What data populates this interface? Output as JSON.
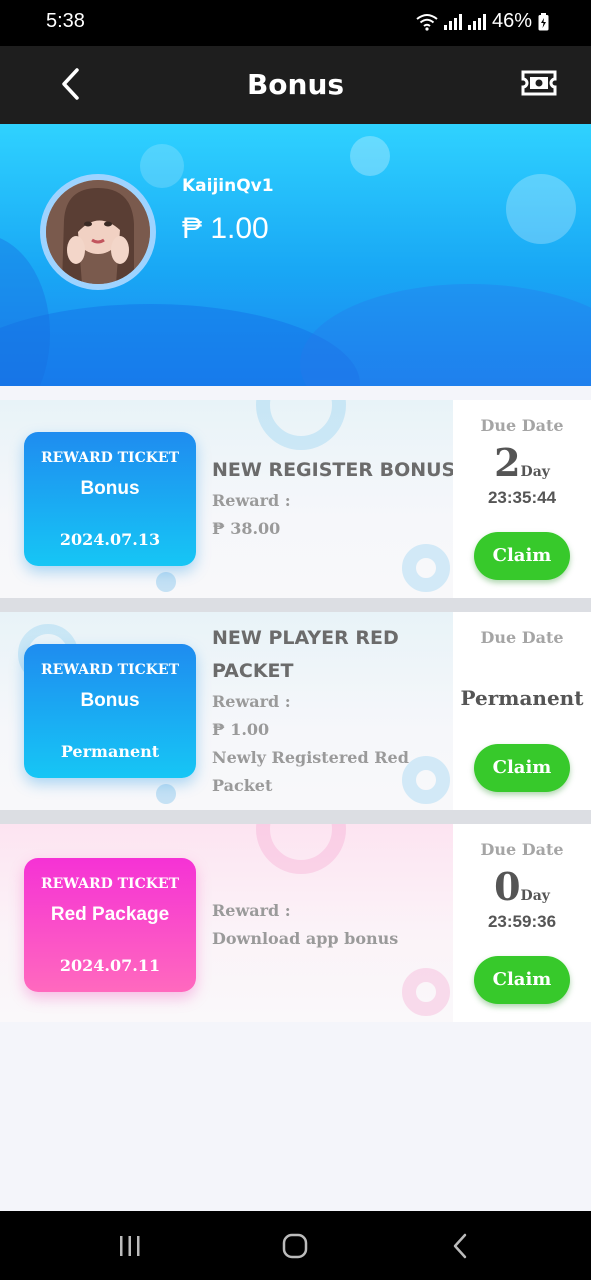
{
  "status_bar": {
    "time": "5:38",
    "battery": "46%"
  },
  "header": {
    "title": "Bonus"
  },
  "profile": {
    "username": "KaijinQv1",
    "balance": "₱ 1.00"
  },
  "tickets": [
    {
      "ticket_label": "REWARD TICKET",
      "ticket_name": "Bonus",
      "ticket_date": "2024.07.13",
      "title": "NEW REGISTER BONUS",
      "reward_label": "Reward :",
      "reward_value": "₱ 38.00",
      "due_label": "Due Date",
      "due_days": "2",
      "due_unit": "Day",
      "due_time": "23:35:44",
      "claim_label": "Claim"
    },
    {
      "ticket_label": "REWARD TICKET",
      "ticket_name": "Bonus",
      "ticket_date": "Permanent",
      "title_line1": "NEW PLAYER RED",
      "title_line2": "PACKET",
      "reward_label": "Reward :",
      "reward_value": "₱ 1.00",
      "desc_line1": "Newly Registered Red",
      "desc_line2": "Packet",
      "due_label": "Due Date",
      "due_perm": "Permanent",
      "claim_label": "Claim"
    },
    {
      "ticket_label": "REWARD TICKET",
      "ticket_name": "Red Package",
      "ticket_date": "2024.07.11",
      "reward_label": "Reward :",
      "reward_value": "Download app bonus",
      "due_label": "Due Date",
      "due_days": "0",
      "due_unit": "Day",
      "due_time": "23:59:36",
      "claim_label": "Claim"
    }
  ],
  "colors": {
    "header_bg": "#1e1e1e",
    "banner_top": "#2fd2ff",
    "banner_bottom": "#1b84ef",
    "ticket_blue": "#1f8cf0",
    "ticket_pink": "#f532d5",
    "claim_green": "#37c92b"
  },
  "icons": {
    "back": "chevron-left-icon",
    "ticket": "ticket-icon",
    "wifi": "wifi-icon",
    "signal": "signal-icon",
    "battery": "battery-icon",
    "nav_recents": "recents-icon",
    "nav_home": "home-icon",
    "nav_back": "back-icon"
  }
}
